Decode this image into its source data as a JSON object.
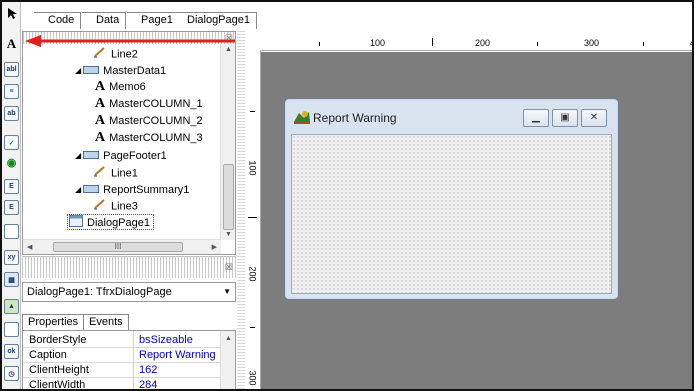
{
  "tabs": [
    "Code",
    "Data",
    "Page1",
    "DialogPage1"
  ],
  "tree": {
    "items": [
      {
        "label": "Line2",
        "icon": "line-icon"
      },
      {
        "label": "MasterData1",
        "icon": "band-icon"
      },
      {
        "label": "Memo6",
        "icon": "text-icon"
      },
      {
        "label": "MasterCOLUMN_1",
        "icon": "text-icon"
      },
      {
        "label": "MasterCOLUMN_2",
        "icon": "text-icon"
      },
      {
        "label": "MasterCOLUMN_3",
        "icon": "text-icon"
      },
      {
        "label": "PageFooter1",
        "icon": "band-icon"
      },
      {
        "label": "Line1",
        "icon": "line-icon"
      },
      {
        "label": "ReportSummary1",
        "icon": "band-icon"
      },
      {
        "label": "Line3",
        "icon": "line-icon"
      },
      {
        "label": "DialogPage1",
        "icon": "dialog-page-icon"
      }
    ],
    "hscroll_label": "III"
  },
  "selector": {
    "value": "DialogPage1: TfrxDialogPage"
  },
  "inspector": {
    "tabs": [
      "Properties",
      "Events"
    ],
    "rows": [
      {
        "key": "BorderStyle",
        "value": "bsSizeable"
      },
      {
        "key": "Caption",
        "value": "Report Warning"
      },
      {
        "key": "ClientHeight",
        "value": "162"
      },
      {
        "key": "ClientWidth",
        "value": "284"
      }
    ]
  },
  "ruler": {
    "top_labels": [
      "100",
      "200",
      "300",
      "4"
    ],
    "left_labels": [
      "100",
      "200",
      "300"
    ]
  },
  "dialog": {
    "title": "Report Warning"
  },
  "palette": {
    "items": [
      "pointer-icon",
      "text-tool-icon",
      "label-icon",
      "memo-icon",
      "button-icon",
      "checkbox-icon",
      "radio-icon",
      "listbox-icon",
      "combobox-icon",
      "panel-icon",
      "groupbox-icon",
      "grid-icon",
      "image-icon",
      "bevel-icon",
      "ok-button-icon",
      "datetime-icon"
    ]
  },
  "colors": {
    "annotation_arrow": "#e0201e",
    "canvas": "#7d7d7d",
    "property_value": "#0000cc"
  }
}
